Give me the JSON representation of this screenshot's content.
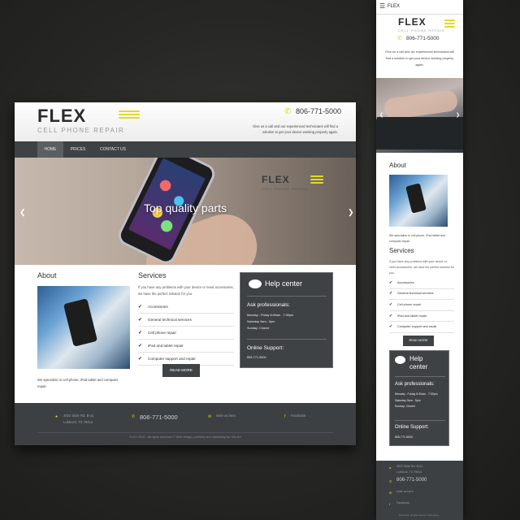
{
  "brand": {
    "logo": "FLEX",
    "tagline_sub": "CELL PHONE REPAIR",
    "phone": "806-771-5000",
    "accent_color": "#e0dc1e",
    "dark_color": "#3f4244"
  },
  "header": {
    "intro": "Give us a call and our experienced technicians will find a solution to get your device working properly again."
  },
  "nav": {
    "items": [
      "HOME",
      "PRICES",
      "CONTACT US"
    ],
    "active": "HOME"
  },
  "hero": {
    "title": "Top quality parts",
    "logo": "FLEX",
    "logo_sub": "CELL PHONE REPAIR",
    "prev_icon": "chevron-left-icon",
    "next_icon": "chevron-right-icon"
  },
  "about": {
    "heading": "About",
    "text": "We specialize in cell phone, iPad tablet and computer repair."
  },
  "services": {
    "heading": "Services",
    "intro": "If you have any problems with your device or need accessories, we have the perfect solution for you.",
    "items": [
      "Accessories",
      "General technical services",
      "Cell phone repair",
      "iPad and tablet repair",
      "Computer support and repair"
    ],
    "button": "READ MORE"
  },
  "help": {
    "heading": "Help center",
    "ask_title": "Ask professionals:",
    "hours": [
      "Monday - Friday 8:30am - 7:00pm",
      "Saturday 9am - 5pm",
      "Sunday: Closed"
    ],
    "online_title": "Online Support:",
    "online_phone": "806-771-5000"
  },
  "footer": {
    "address_line1": "3022 Slide Rd. B-31",
    "address_line2": "Lubbock, TX 79414",
    "phone": "806-771-5000",
    "email": "write us here",
    "social": "Facebook",
    "copyright": "FLEX 2016 - all rights reserved © Web design, publicity and marketing by: Cllo Art"
  },
  "mobile": {
    "menu_title": "FLEX",
    "copyright": "FLEX 2016 - all rights reserved © Web design..."
  }
}
